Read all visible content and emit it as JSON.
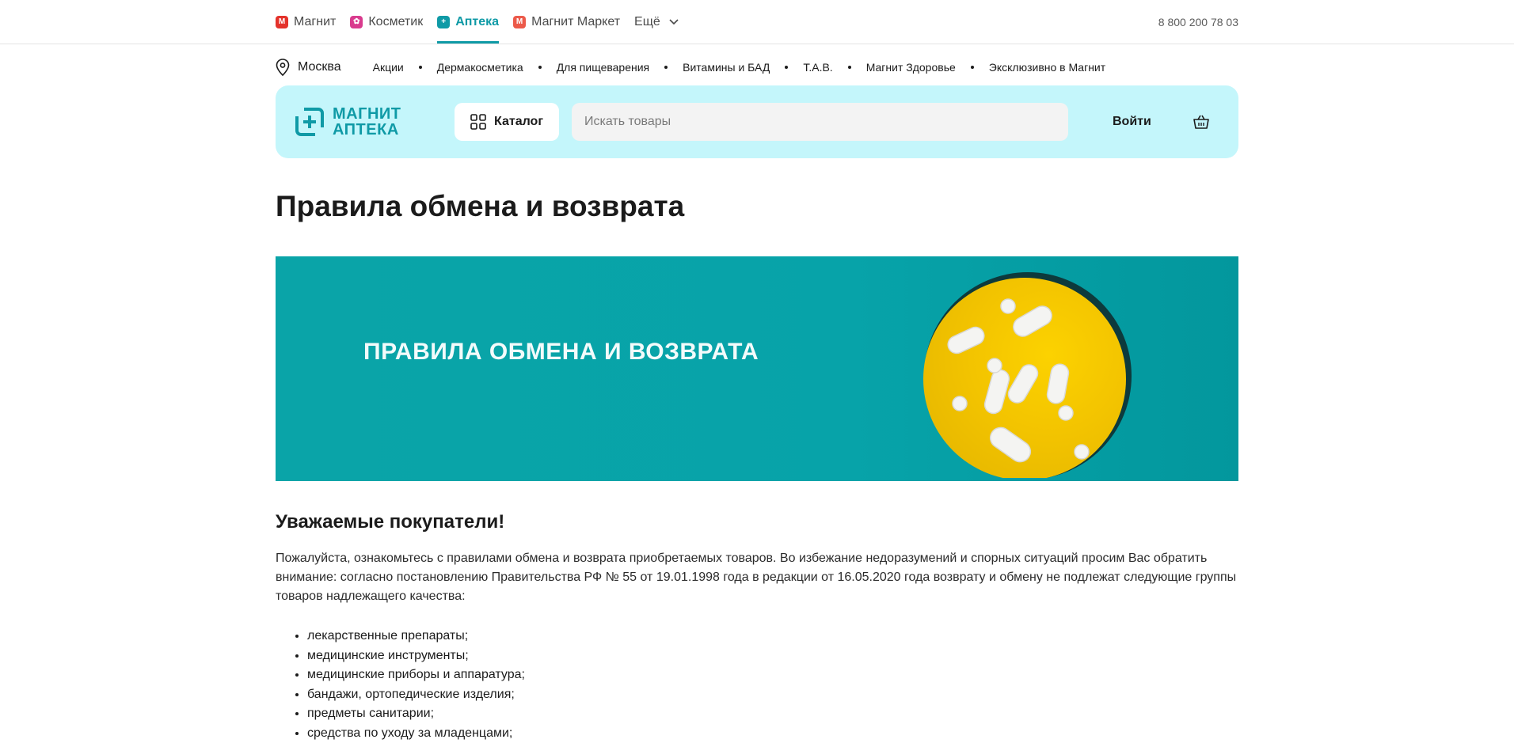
{
  "brands": [
    {
      "label": "Магнит",
      "icon": "magnit-icon",
      "color": "#e4322b",
      "active": false
    },
    {
      "label": "Косметик",
      "icon": "kosmetik-icon",
      "color": "#d93b8e",
      "active": false
    },
    {
      "label": "Аптека",
      "icon": "apteka-icon",
      "color": "#0f9aa6",
      "active": true
    },
    {
      "label": "Магнит Маркет",
      "icon": "market-icon",
      "color": "#ec5a4a",
      "active": false
    }
  ],
  "more_label": "Ещё",
  "phone": "8 800 200 78 03",
  "city": "Москва",
  "nav_links": [
    "Акции",
    "Дермакосметика",
    "Для пищеварения",
    "Витамины и БАД",
    "Т.А.В.",
    "Магнит Здоровье",
    "Эксклюзивно в Магнит"
  ],
  "header": {
    "logo_line1": "МАГНИТ",
    "logo_line2": "АПТЕКА",
    "catalog_label": "Каталог",
    "search_placeholder": "Искать товары",
    "login_label": "Войти"
  },
  "page_title": "Правила обмена и возврата",
  "banner_title": "ПРАВИЛА ОБМЕНА И ВОЗВРАТА",
  "section_title": "Уважаемые покупатели!",
  "intro": "Пожалуйста, ознакомьтесь с правилами обмена и возврата приобретаемых товаров. Во избежание недоразумений и спорных ситуаций просим Вас обратить внимание: согласно постановлению Правительства РФ № 55 от 19.01.1998 года в редакции от 16.05.2020 года возврату и обмену не подлежат следующие группы товаров надлежащего качества:",
  "rules": [
    "лекарственные препараты;",
    "медицинские инструменты;",
    "медицинские приборы и аппаратура;",
    "бандажи, ортопедические изделия;",
    "предметы санитарии;",
    "средства по уходу за младенцами;"
  ]
}
